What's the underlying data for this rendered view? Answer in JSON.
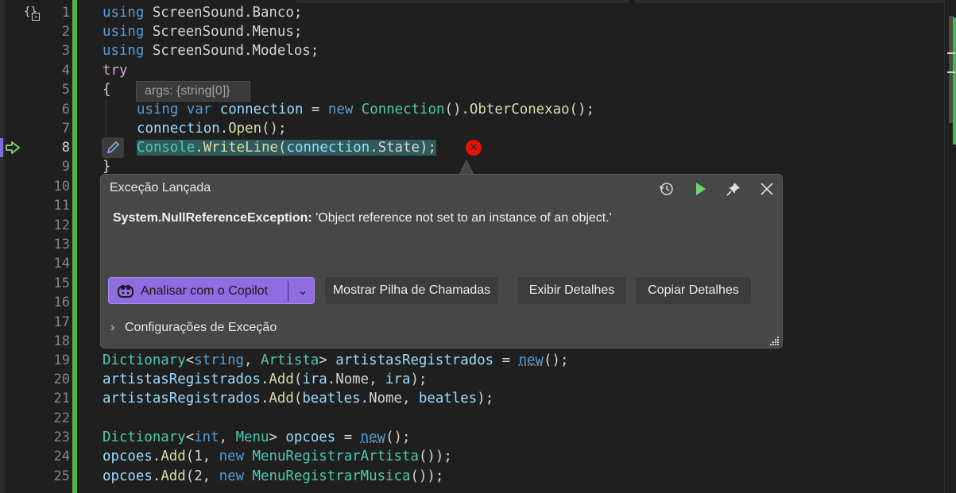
{
  "editor": {
    "lines": [
      {
        "num": "1"
      },
      {
        "num": "2"
      },
      {
        "num": "3"
      },
      {
        "num": "4"
      },
      {
        "num": "5"
      },
      {
        "num": "6"
      },
      {
        "num": "7"
      },
      {
        "num": "8"
      },
      {
        "num": "9"
      },
      {
        "num": "10"
      },
      {
        "num": "11"
      },
      {
        "num": "12"
      },
      {
        "num": "13"
      },
      {
        "num": "14"
      },
      {
        "num": "15"
      },
      {
        "num": "16"
      },
      {
        "num": "17"
      },
      {
        "num": "18"
      },
      {
        "num": "19"
      },
      {
        "num": "20"
      },
      {
        "num": "21"
      },
      {
        "num": "22"
      },
      {
        "num": "23"
      },
      {
        "num": "24"
      },
      {
        "num": "25"
      }
    ],
    "current_line": "8",
    "code": {
      "l1": [
        "using",
        " ScreenSound.Banco;"
      ],
      "l2": [
        "using",
        " ScreenSound.Menus;"
      ],
      "l3": [
        "using",
        " ScreenSound.Modelos;"
      ],
      "l4": "try",
      "l5": "{",
      "l6": [
        "using",
        " ",
        "var",
        " ",
        "connection",
        " = ",
        "new",
        " ",
        "Connection",
        "().",
        "ObterConexao",
        "();"
      ],
      "l7": [
        "connection",
        ".",
        "Open",
        "();"
      ],
      "l8": [
        "Console",
        ".",
        "WriteLine",
        "(",
        "connection",
        ".State);"
      ],
      "l9": "}",
      "l19": [
        "Dictionary",
        "<",
        "string",
        ", ",
        "Artista",
        "> ",
        "artistasRegistrados",
        " = ",
        "new",
        "();"
      ],
      "l20": [
        "artistasRegistrados",
        ".",
        "Add",
        "(",
        "ira",
        ".Nome, ",
        "ira",
        ");"
      ],
      "l21": [
        "artistasRegistrados",
        ".",
        "Add",
        "(",
        "beatles",
        ".Nome, ",
        "beatles",
        ");"
      ],
      "l23": [
        "Dictionary",
        "<",
        "int",
        ", ",
        "Menu",
        "> ",
        "opcoes",
        " = ",
        "new",
        "();"
      ],
      "l24": [
        "opcoes",
        ".",
        "Add",
        "(1, ",
        "new",
        " ",
        "MenuRegistrarArtista",
        "());"
      ],
      "l25": [
        "opcoes",
        ".",
        "Add",
        "(2, ",
        "new",
        " ",
        "MenuRegistrarMusica",
        "());"
      ]
    }
  },
  "datatip": {
    "text": "args: {string[0]}"
  },
  "exception_popup": {
    "title": "Exceção Lançada",
    "exception_type": "System.NullReferenceException:",
    "exception_message": " 'Object reference not set to an instance of an object.'",
    "buttons": {
      "copilot": "Analisar com o Copilot",
      "call_stack": "Mostrar Pilha de Chamadas",
      "details": "Exibir Detalhes",
      "copy": "Copiar Detalhes"
    },
    "settings": "Configurações de Exceção"
  },
  "colors": {
    "change_bar": "#4fb54a",
    "error": "#e51400",
    "copilot_button": "#8f6ce0",
    "run_icon": "#6fd36f"
  }
}
